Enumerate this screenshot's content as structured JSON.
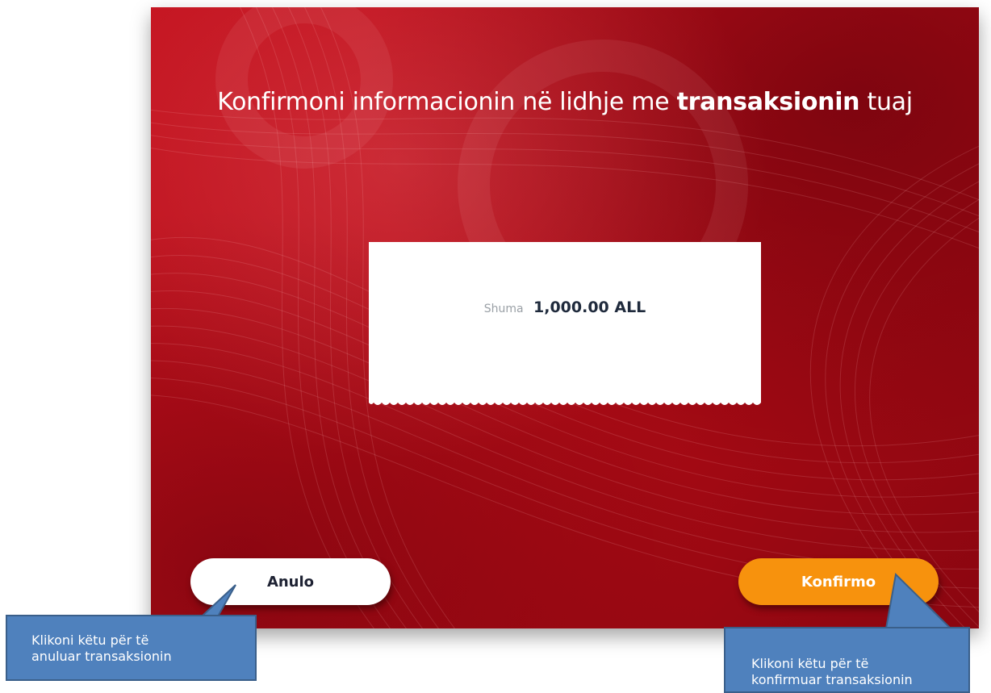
{
  "screen": {
    "headline_pre": "Konfirmoni informacionin në lidhje me",
    "headline_bold": "transaksionin",
    "headline_post": "tuaj"
  },
  "receipt": {
    "amount_label": "Shuma",
    "amount_value": "1,000.00 ALL"
  },
  "buttons": {
    "cancel_label": "Anulo",
    "confirm_label": "Konfirmo"
  },
  "callouts": {
    "cancel_line1": "Klikoni këtu për të",
    "cancel_line2": "anuluar transaksionin",
    "confirm_line1": "Klikoni këtu për të",
    "confirm_line2": "konfirmuar transaksionin"
  },
  "colors": {
    "screen_red": "#b50d18",
    "confirm_orange": "#f7920d",
    "callout_blue": "#4f81bd"
  }
}
